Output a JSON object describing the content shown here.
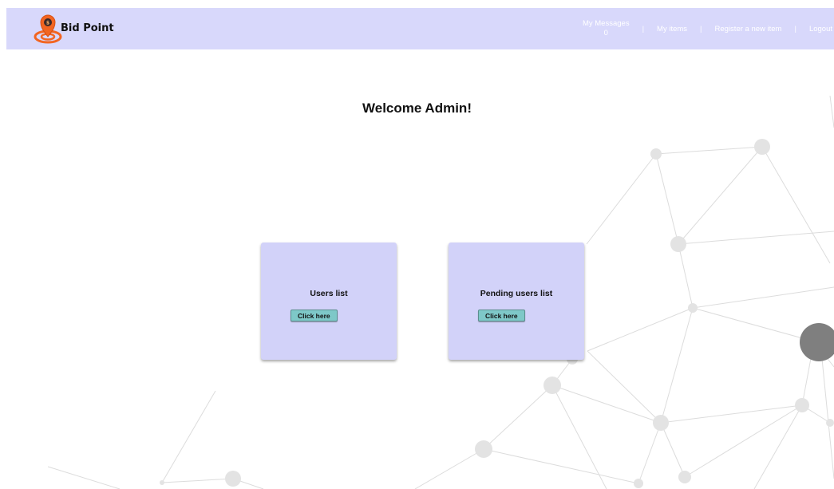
{
  "navbar": {
    "brand": "Bid Point",
    "messages_label": "My Messages",
    "messages_count": "0",
    "my_items": "My items",
    "register_item": "Register a new item",
    "logout": "Logout",
    "separator": "|"
  },
  "welcome": "Welcome Admin!",
  "cards": [
    {
      "title": "Users list",
      "button": "Click here"
    },
    {
      "title": "Pending users list",
      "button": "Click here"
    }
  ],
  "colors": {
    "navbar_bg": "#d8d8fb",
    "card_bg": "#d2d2f9",
    "button_bg": "#7ec8c8",
    "logo": "#f26522"
  }
}
